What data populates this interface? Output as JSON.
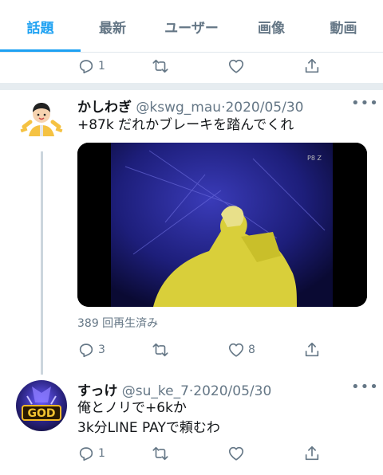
{
  "tabs": [
    {
      "label": "話題"
    },
    {
      "label": "最新"
    },
    {
      "label": "ユーザー"
    },
    {
      "label": "画像"
    },
    {
      "label": "動画"
    }
  ],
  "top_actions": {
    "reply_count": "1"
  },
  "tweet1": {
    "name": "かしわぎ",
    "handle": "@kswg_mau",
    "sep": "·",
    "date": "2020/05/30",
    "text": "+87k だれかブレーキを踏んでくれ",
    "video_views": "389 回再生済み",
    "reply_count": "3",
    "like_count": "8"
  },
  "tweet2": {
    "name": "すっけ",
    "handle": "@su_ke_7",
    "sep": "·",
    "date": "2020/05/30",
    "text_line1": "俺とノリで+6kか",
    "text_line2": "3k分LINE PAYで頼むわ",
    "reply_count": "1",
    "avatar_text": "GOD"
  },
  "colors": {
    "accent": "#1da1f2",
    "muted": "#657786",
    "divider": "#e6ecf0"
  }
}
